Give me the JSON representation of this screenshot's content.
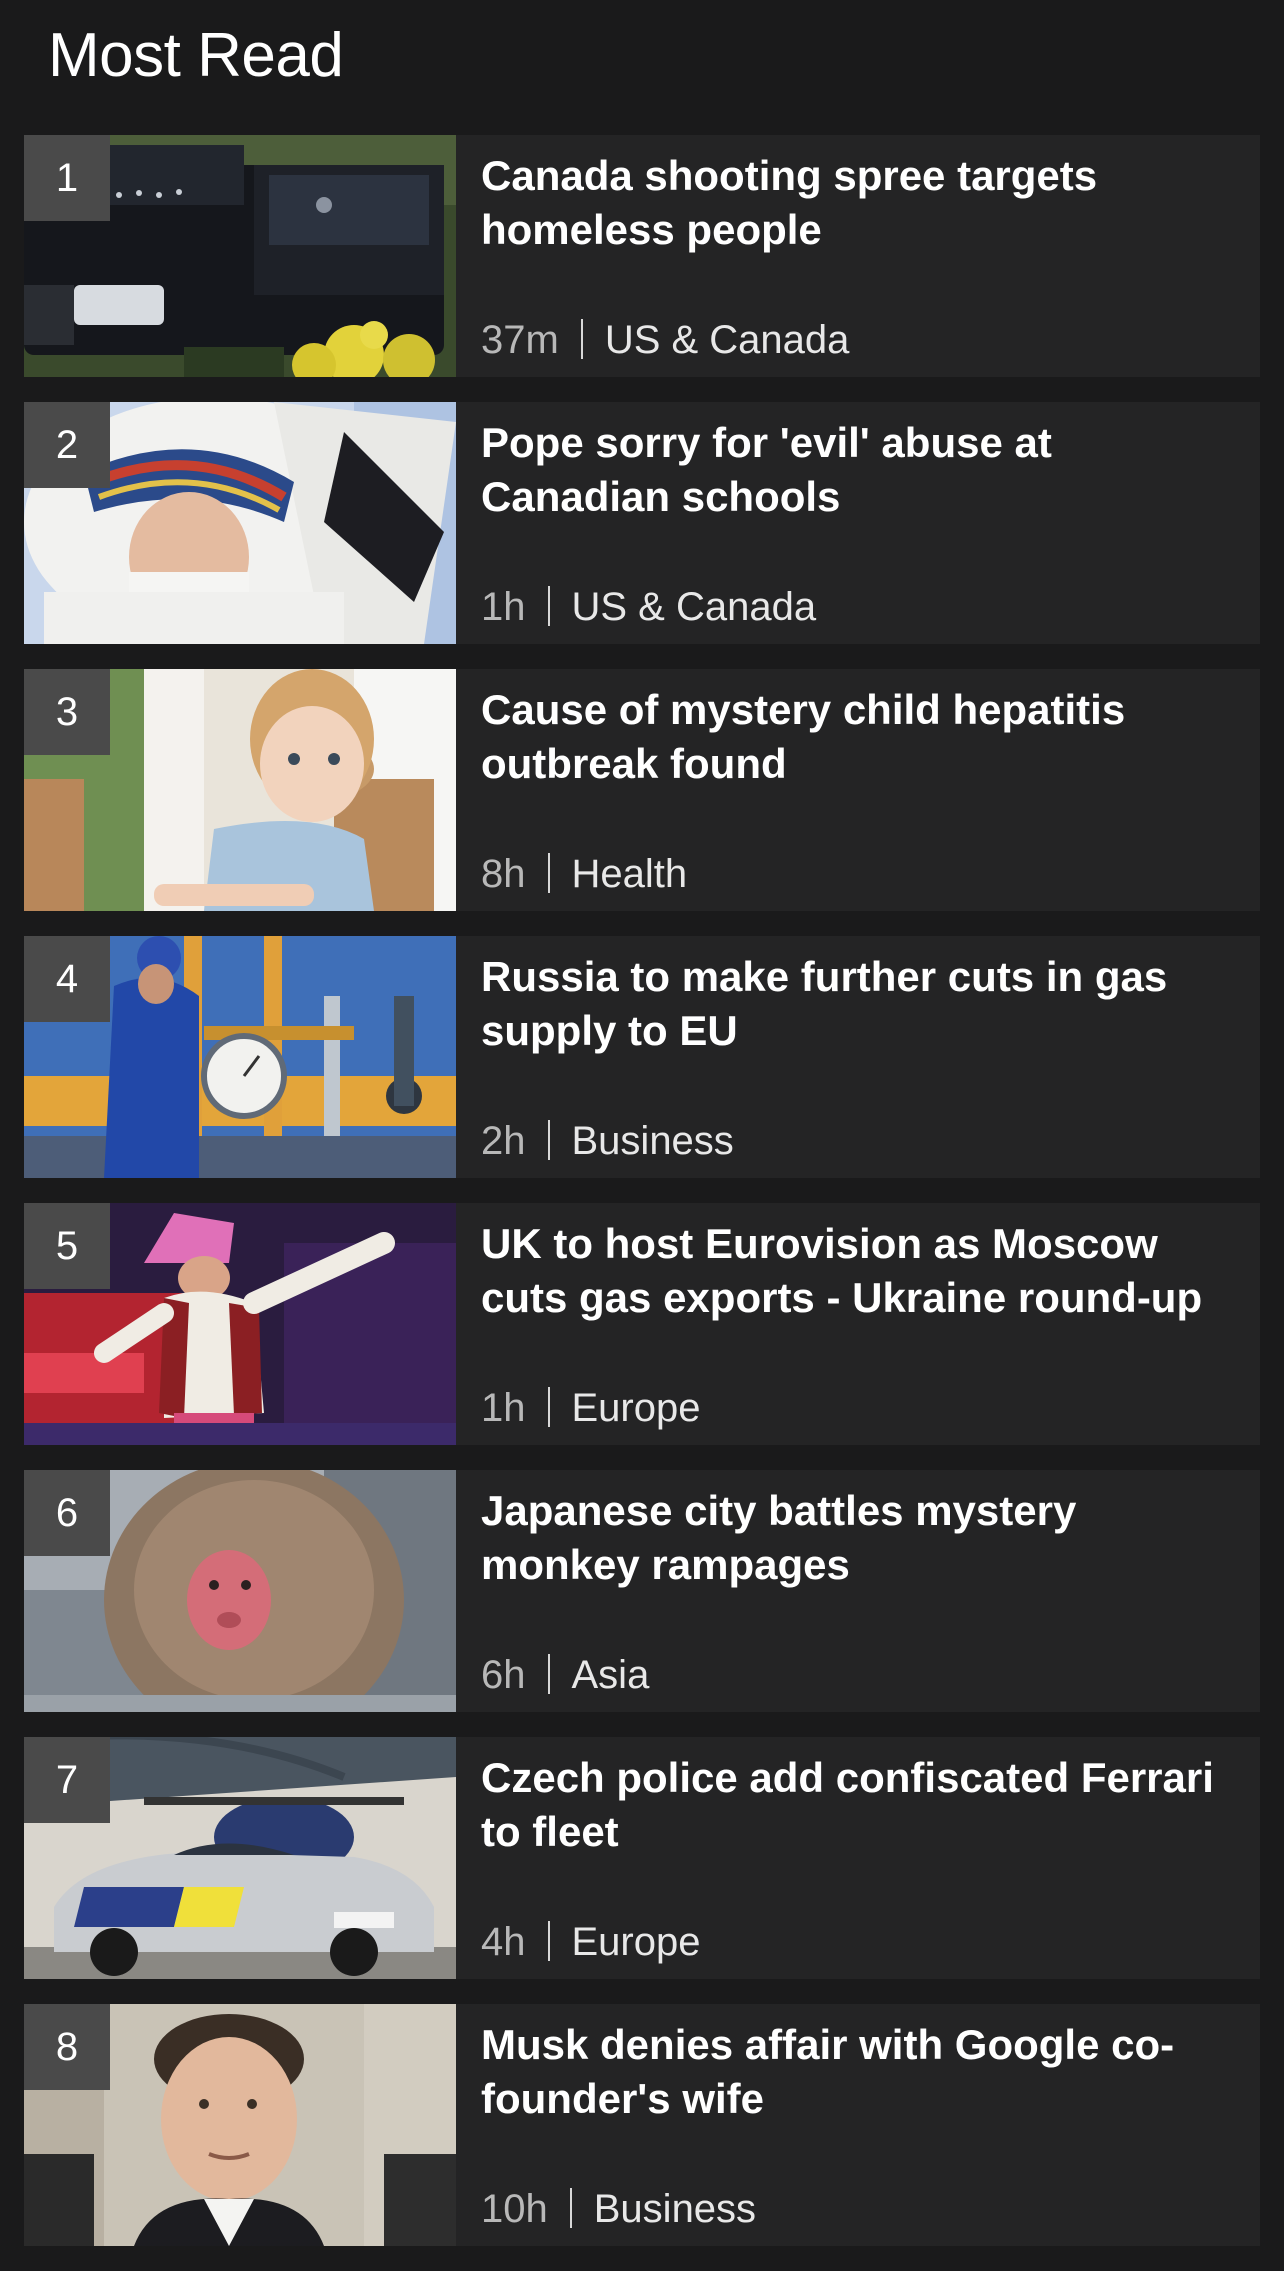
{
  "section_title": "Most Read",
  "items": [
    {
      "rank": "1",
      "headline": "Canada shooting spree targets homeless people",
      "time": "37m",
      "topic": "US & Canada",
      "image": "shot-vehicle-photo"
    },
    {
      "rank": "2",
      "headline": "Pope sorry for 'evil' abuse at Canadian schools",
      "time": "1h",
      "topic": "US & Canada",
      "image": "pope-headdress-photo"
    },
    {
      "rank": "3",
      "headline": "Cause of mystery child hepatitis outbreak found",
      "time": "8h",
      "topic": "Health",
      "image": "toddler-photo"
    },
    {
      "rank": "4",
      "headline": "Russia to make further cuts in gas supply to EU",
      "time": "2h",
      "topic": "Business",
      "image": "gas-pipeline-photo"
    },
    {
      "rank": "5",
      "headline": "UK to host Eurovision as Moscow cuts gas exports - Ukraine round-up",
      "time": "1h",
      "topic": "Europe",
      "image": "eurovision-performer-photo"
    },
    {
      "rank": "6",
      "headline": "Japanese city battles mystery monkey rampages",
      "time": "6h",
      "topic": "Asia",
      "image": "macaque-photo"
    },
    {
      "rank": "7",
      "headline": "Czech police add confiscated Ferrari to fleet",
      "time": "4h",
      "topic": "Europe",
      "image": "police-ferrari-photo"
    },
    {
      "rank": "8",
      "headline": "Musk denies affair with Google co-founder's wife",
      "time": "10h",
      "topic": "Business",
      "image": "musk-portrait-photo"
    }
  ],
  "colors": {
    "background": "#1a1a1b",
    "card": "#242425",
    "rank_badge": "#4a4a4a",
    "headline": "#ffffff",
    "meta": "#d8d8d8"
  }
}
